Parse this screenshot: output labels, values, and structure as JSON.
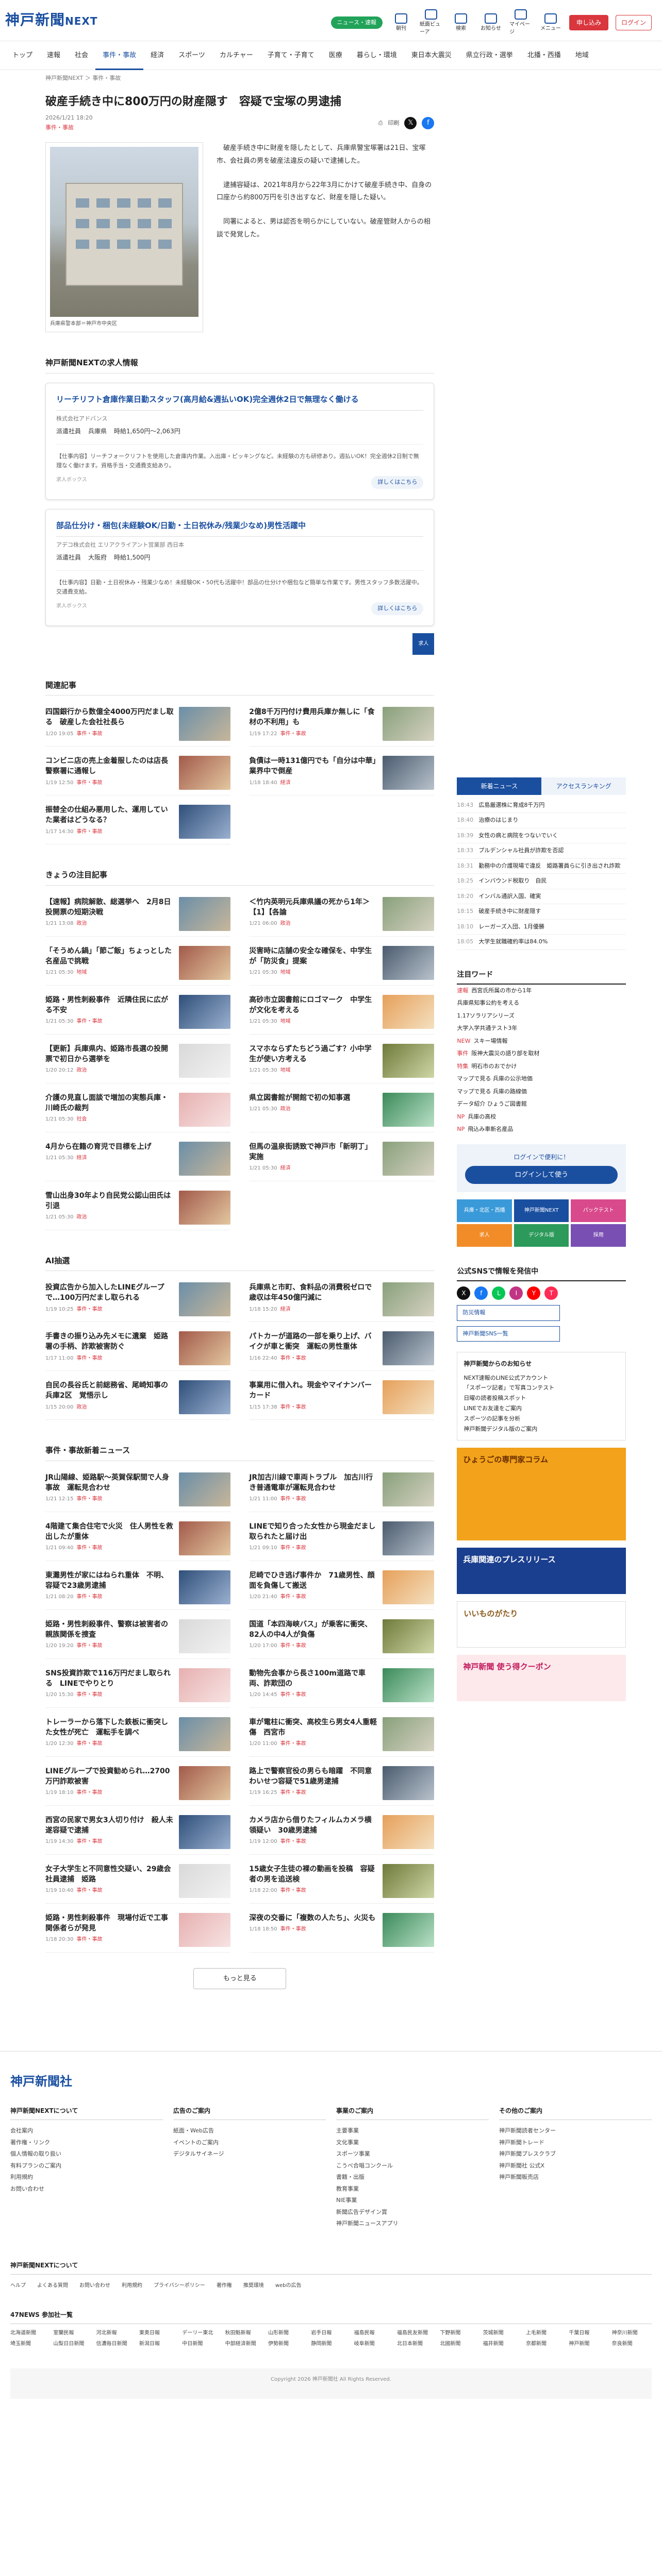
{
  "header": {
    "logo": "神戸新聞",
    "logo_suffix": "NEXT",
    "app_pill": "ニュース・速報",
    "icons": [
      "朝刊",
      "紙面ビューア",
      "検索",
      "お知らせ",
      "マイページ",
      "メニュー"
    ],
    "subscribe": "申し込み",
    "login": "ログイン"
  },
  "gnav": [
    "トップ",
    "速報",
    "社会",
    "事件・事故",
    "経済",
    "スポーツ",
    "カルチャー",
    "子育て・子育て",
    "医療",
    "暮らし・環境",
    "東日本大震災",
    "県立行政・選挙",
    "北播・西播",
    "地域"
  ],
  "breadcrumb": "神戸新聞NEXT ＞ 事件・事故",
  "article": {
    "title": "破産手続き中に800万円の財産隠す　容疑で宝塚の男逮捕",
    "date": "2026/1/21 18:20",
    "category": "事件・事故",
    "share_label": "印刷",
    "photo_caption": "兵庫県警本部＝神戸市中央区",
    "paragraphs": [
      "破産手続き中に財産を隠したとして、兵庫県警宝塚署は21日、宝塚市、会社員の男を破産法違反の疑いで逮捕した。",
      "逮捕容疑は、2021年8月から22年3月にかけて破産手続き中、自身の口座から約800万円を引き出すなど、財産を隠した疑い。",
      "同署によると、男は認否を明らかにしていない。破産管財人からの相談で発覚した。"
    ]
  },
  "jobs": {
    "title": "神戸新聞NEXTの求人情報",
    "cards": [
      {
        "title": "リーチリフト倉庫作業日勤スタッフ(高月給&週払いOK)完全週休2日で無理なく働ける",
        "company": "株式会社アドバンス",
        "facts": [
          "派遣社員",
          "兵庫県",
          "時給1,650円〜2,063円"
        ],
        "desc": "【仕事内容】リーチフォークリフトを使用した倉庫内作業。入出庫・ピッキングなど。未経験の方も研修あり。週払いOK！完全週休2日制で無理なく働けます。資格手当・交通費支給あり。",
        "source": "求人ボックス",
        "more": "詳しくはこちら"
      },
      {
        "title": "部品仕分け・梱包(未経験OK/日勤・土日祝休み/残業少なめ)男性活躍中",
        "company": "アデコ株式会社 エリアクライアント営業部 西日本",
        "facts": [
          "派遣社員",
          "大阪府",
          "時給1,500円"
        ],
        "desc": "【仕事内容】日勤・土日祝休み・残業少なめ！未経験OK・50代も活躍中！部品の仕分けや梱包など簡単な作業です。男性スタッフ多数活躍中。交通費支給。",
        "source": "求人ボックス",
        "more": "詳しくはこちら"
      }
    ],
    "sponsor": "求人"
  },
  "related": {
    "title": "関連記事",
    "items": [
      {
        "hd": "四国銀行から数億全4000万円だまし取る　破産した会社社長ら",
        "mt": "1/20 19:05",
        "cat": "事件・事故"
      },
      {
        "hd": "2億8千万円付け費用兵庫か無しに「食材の不利用」も",
        "mt": "1/19 17:22",
        "cat": "事件・事故"
      },
      {
        "hd": "コンビニ店の売上金着服したのは店長　警察署に通報し",
        "mt": "1/19 12:50",
        "cat": "事件・事故"
      },
      {
        "hd": "負債は一時131億円でも「自分は中華」業界中で倒産",
        "mt": "1/18 18:40",
        "cat": "経済"
      },
      {
        "hd": "振替全の仕組み悪用した、運用していた業者はどうなる？",
        "mt": "1/17 14:30",
        "cat": "事件・事故"
      }
    ]
  },
  "today": {
    "title": "きょうの注目記事",
    "items": [
      {
        "hd": "【速報】病院解散、総選挙へ　2月8日投開票の短期決戦",
        "mt": "1/21 13:08",
        "cat": "政治"
      },
      {
        "hd": "＜竹内英明元兵庫県議の死から1年＞【1】【各論",
        "mt": "1/21 06:00",
        "cat": "政治"
      },
      {
        "hd": "「そうめん鍋」「節ご飯」ちょっとした名産品で挑戦",
        "mt": "1/21 05:30",
        "cat": "地域"
      },
      {
        "hd": "災害時に店舗の安全な確保を、中学生が「防災食」提案",
        "mt": "1/21 05:30",
        "cat": "地域"
      },
      {
        "hd": "姫路・男性刺殺事件　近隣住民に広がる不安",
        "mt": "1/21 05:30",
        "cat": "事件・事故"
      },
      {
        "hd": "高砂市立図書館にロゴマーク　中学生が文化を考える",
        "mt": "1/21 05:30",
        "cat": "地域"
      },
      {
        "hd": "【更新】兵庫県内、姫路市長選の投開票で初日から選挙を",
        "mt": "1/20 20:12",
        "cat": "政治"
      },
      {
        "hd": "スマホならずたちどう過ごす？小中学生が使い方考える",
        "mt": "1/21 05:30",
        "cat": "地域"
      },
      {
        "hd": "介護の見直し面談で増加の実態兵庫・川崎氏の裁判",
        "mt": "1/21 05:30",
        "cat": "社会"
      },
      {
        "hd": "県立図書館が開館で初の知事選",
        "mt": "1/21 05:30",
        "cat": "政治"
      },
      {
        "hd": "4月から在籍の育児で目標を上げ",
        "mt": "1/21 05:30",
        "cat": "経済"
      },
      {
        "hd": "但馬の温泉街誘致で神戸市「新明丁」実施",
        "mt": "1/21 05:30",
        "cat": "経済"
      },
      {
        "hd": "雪山出身30年より自民党公認山田氏は引退",
        "mt": "1/21 05:30",
        "cat": "政治"
      }
    ]
  },
  "ai": {
    "title": "AI抽選",
    "items": [
      {
        "hd": "投資広告から加入したLINEグループで…100万円だまし取られる",
        "mt": "1/19 10:25",
        "cat": "事件・事故"
      },
      {
        "hd": "兵庫県と市町、食料品の消費税ゼロで歳収は年450億円減に",
        "mt": "1/18 15:20",
        "cat": "経済"
      },
      {
        "hd": "手書きの振り込み先メモに遺棄　姫路署の手柄、詐欺被害防ぐ",
        "mt": "1/17 11:00",
        "cat": "事件・事故"
      },
      {
        "hd": "パトカーが道路の一部を乗り上げ、バイクが車と衝突　運転の男性重体",
        "mt": "1/16 22:40",
        "cat": "事件・事故"
      },
      {
        "hd": "自民の長谷氏と前総務省、尾崎知事の兵庫2区　覚悟示し",
        "mt": "1/15 20:00",
        "cat": "政治"
      },
      {
        "hd": "事業用に借入れ。現金やマイナンバーカード",
        "mt": "1/15 17:38",
        "cat": "事件・事故"
      }
    ]
  },
  "incidents": {
    "title": "事件・事故新着ニュース",
    "items": [
      {
        "hd": "JR山陽線、姫路駅〜英賀保駅間で人身事故　運転見合わせ",
        "mt": "1/21 12:15",
        "cat": "事件・事故"
      },
      {
        "hd": "JR加古川線で車両トラブル　加古川行き普通電車が運転見合わせ",
        "mt": "1/21 11:00",
        "cat": "事件・事故"
      },
      {
        "hd": "4階建て集合住宅で火災　住人男性を救出したが重体",
        "mt": "1/21 09:40",
        "cat": "事件・事故"
      },
      {
        "hd": "LINEで知り合った女性から現金だまし取られたと届け出",
        "mt": "1/21 09:10",
        "cat": "事件・事故"
      },
      {
        "hd": "東灘男性が家にはねられ重体　不明、容疑で23歳男逮捕",
        "mt": "1/21 08:20",
        "cat": "事件・事故"
      },
      {
        "hd": "尼崎でひき逃げ事件か　71歳男性、顔面を負傷して搬送",
        "mt": "1/20 21:40",
        "cat": "事件・事故"
      },
      {
        "hd": "姫路・男性刺殺事件、警察は被害者の親族関係を捜査",
        "mt": "1/20 19:20",
        "cat": "事件・事故"
      },
      {
        "hd": "国道「本四海峡バス」が乗客に衝突、82人の中4人が負傷",
        "mt": "1/20 17:00",
        "cat": "事件・事故"
      },
      {
        "hd": "SNS投資詐欺で116万円だまし取られる　LINEでやりとり",
        "mt": "1/20 15:30",
        "cat": "事件・事故"
      },
      {
        "hd": "動物先会事から長さ100m道路で車両、詐欺団の",
        "mt": "1/20 14:45",
        "cat": "事件・事故"
      },
      {
        "hd": "トレーラーから落下した鉄板に衝突した女性が死亡　運転手を調べ",
        "mt": "1/20 12:30",
        "cat": "事件・事故"
      },
      {
        "hd": "車が電柱に衝突、高校生ら男女4人重軽傷　西宮市",
        "mt": "1/20 11:00",
        "cat": "事件・事故"
      },
      {
        "hd": "LINEグループで投資勧められ…2700万円詐欺被害",
        "mt": "1/19 18:10",
        "cat": "事件・事故"
      },
      {
        "hd": "路上で警察官役の男らも暗躍　不同意わいせつ容疑で51歳男逮捕",
        "mt": "1/19 16:25",
        "cat": "事件・事故"
      },
      {
        "hd": "西宮の民家で男女3人切り付け　殺人未遂容疑で逮捕",
        "mt": "1/19 14:30",
        "cat": "事件・事故"
      },
      {
        "hd": "カメラ店から借りたフィルムカメラ横領疑い　30歳男逮捕",
        "mt": "1/19 12:00",
        "cat": "事件・事故"
      },
      {
        "hd": "女子大学生と不同意性交疑い、29歳会社員逮捕　姫路",
        "mt": "1/19 10:40",
        "cat": "事件・事故"
      },
      {
        "hd": "15歳女子生徒の裸の動画を投稿　容疑者の男を追送検",
        "mt": "1/18 22:00",
        "cat": "事件・事故"
      },
      {
        "hd": "姫路・男性刺殺事件　現場付近で工事関係者らが発見",
        "mt": "1/18 20:30",
        "cat": "事件・事故"
      },
      {
        "hd": "深夜の交番に「複数の人たち」、火災も",
        "mt": "1/18 18:50",
        "cat": "事件・事故"
      }
    ],
    "more": "もっと見る"
  },
  "sidebar": {
    "tabs": [
      "新着ニュース",
      "アクセスランキング"
    ],
    "rank": [
      {
        "t": "18:43",
        "hd": "広島厳選株に育成8千万円"
      },
      {
        "t": "18:40",
        "hd": "治療のはじまり"
      },
      {
        "t": "18:39",
        "hd": "女性の病と病院をつないでいく"
      },
      {
        "t": "18:33",
        "hd": "プルデンシャル社員が詐欺を否認"
      },
      {
        "t": "18:31",
        "hd": "勤務中の介護現場で違反　姫路署員らに引き出され詐欺"
      },
      {
        "t": "18:25",
        "hd": "インバウンド税取り　自民"
      },
      {
        "t": "18:20",
        "hd": "インバル通訳入国、確実"
      },
      {
        "t": "18:15",
        "hd": "破産手続き中に財産隠す"
      },
      {
        "t": "18:10",
        "hd": "レーガーズ入団、1月優勝"
      },
      {
        "t": "18:05",
        "hd": "大学生就職確約率は84.0%"
      }
    ],
    "kw_title": "注目ワード",
    "keywords": [
      {
        "b": "速報",
        "w": "西宮氏所属の市から1年"
      },
      {
        "b": "",
        "w": "兵庫県知事公約を考える"
      },
      {
        "b": "",
        "w": "1.17ソラリアシリーズ"
      },
      {
        "b": "",
        "w": "大学入学共通テスト3年"
      },
      {
        "b": "NEW",
        "w": "スキー場情報"
      },
      {
        "b": "事件",
        "w": "阪神大震災の語り部を取材"
      },
      {
        "b": "特集",
        "w": "明石市のおでかけ"
      },
      {
        "b": "",
        "w": "マップで見る 兵庫の公示地価"
      },
      {
        "b": "",
        "w": "マップで見る 兵庫の路線価"
      },
      {
        "b": "",
        "w": "データ紹介 ひょうご図書館"
      },
      {
        "b": "NP",
        "w": "兵庫の高校"
      },
      {
        "b": "NP",
        "w": "飛込み車新名産品"
      }
    ],
    "login_text": "ログインで便利に！",
    "login_btn": "ログインして使う",
    "promos": [
      "兵庫・北区・西播",
      "神戸新聞NEXT",
      "パックテスト",
      "求人",
      "デジタル版",
      "採用"
    ],
    "sns_title": "公式SNSで情報を発信中",
    "sns": [
      "X",
      "f",
      "L",
      "I",
      "Y",
      "T"
    ],
    "links": [
      "防災情報",
      "神戸新聞SNS一覧"
    ],
    "notice_title": "神戸新聞からのお知らせ",
    "notices": [
      "NEXT速報のLINE公式アカウント",
      "「スポーツ記者」で写真コンテスト",
      "日曜の読者投稿スポット",
      "LINEでお友達をご案内",
      "スポーツの記事を分析",
      "神戸新聞デジタル版のご案内"
    ],
    "banners": [
      "ひょうごの専門家コラム",
      "兵庫関連のプレスリリース",
      "いいものがたり",
      "神戸新聞 使う得クーポン"
    ]
  },
  "footer": {
    "logo": "神戸新聞社",
    "cols": [
      {
        "h": "神戸新聞NEXTについて",
        "items": [
          "会社案内",
          "著作権・リンク",
          "個人情報の取り扱い",
          "有料プランのご案内",
          "利用規約",
          "お問い合わせ"
        ]
      },
      {
        "h": "広告のご案内",
        "items": [
          "紙面・Web広告",
          "イベントのご案内",
          "デジタルサイネージ"
        ]
      },
      {
        "h": "事業のご案内",
        "items": [
          "主要事業",
          "文化事業",
          "スポーツ事業",
          "こうべ合唱コンクール",
          "書籍・出版",
          "教育事業",
          "NIE事業",
          "新聞広告デザイン賞",
          "神戸新聞ニュースアプリ"
        ]
      },
      {
        "h": "その他のご案内",
        "items": [
          "神戸新聞読者センター",
          "神戸新聞トレード",
          "神戸新聞プレスクラブ",
          "神戸新聞社 公式X",
          "神戸新聞販売店"
        ]
      }
    ],
    "about": "神戸新聞NEXTについて",
    "links": [
      "ヘルプ",
      "よくある質問",
      "お問い合わせ",
      "利用規約",
      "プライバシーポリシー",
      "著作権",
      "推奨環境",
      "webの広告"
    ],
    "f47": "47NEWS 参加社一覧",
    "members": [
      "北海道新聞",
      "室蘭民報",
      "河北新報",
      "東奥日報",
      "デーリー東北",
      "秋田魁新報",
      "山形新聞",
      "岩手日報",
      "福島民報",
      "福島民友新聞",
      "下野新聞",
      "茨城新聞",
      "上毛新聞",
      "千葉日報",
      "神奈川新聞",
      "埼玉新聞",
      "山梨日日新聞",
      "信濃毎日新聞",
      "新潟日報",
      "中日新聞",
      "中部経済新聞",
      "伊勢新聞",
      "静岡新聞",
      "岐阜新聞",
      "北日本新聞",
      "北國新聞",
      "福井新聞",
      "京都新聞",
      "神戸新聞",
      "奈良新聞"
    ],
    "copyright": "Copyright 2026 神戸新聞社 All Rights Reserved."
  }
}
